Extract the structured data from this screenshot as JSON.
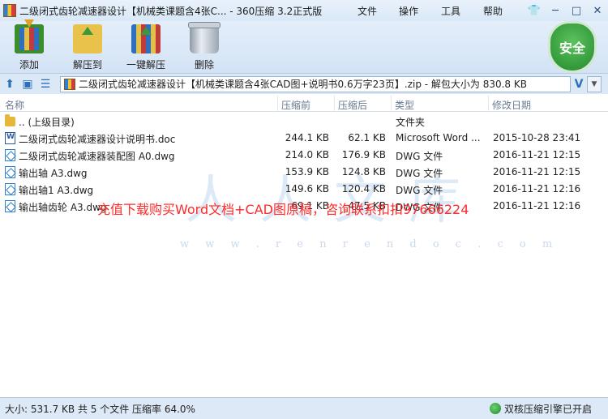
{
  "window": {
    "title": "二级闭式齿轮减速器设计【机械类课题含4张C... - 360压缩 3.2正式版",
    "menu": [
      "文件",
      "操作",
      "工具",
      "帮助"
    ],
    "controls": [
      "shirt-icon",
      "minimize-icon",
      "maximize-icon",
      "close-icon"
    ]
  },
  "toolbar": {
    "items": [
      {
        "label": "添加",
        "icon": "add-archive-icon"
      },
      {
        "label": "解压到",
        "icon": "extract-to-icon"
      },
      {
        "label": "一键解压",
        "icon": "one-click-extract-icon"
      },
      {
        "label": "删除",
        "icon": "trash-icon"
      }
    ],
    "security_badge": "安全"
  },
  "address": {
    "path": "二级闭式齿轮减速器设计【机械类课题含4张CAD图+说明书0.6万字23页】.zip - 解包大小为 830.8 KB",
    "v_label": "V"
  },
  "columns": [
    "名称",
    "压缩前",
    "压缩后",
    "类型",
    "修改日期"
  ],
  "files": [
    {
      "icon": "folder",
      "name": ".. (上级目录)",
      "size": "",
      "packed": "",
      "type": "文件夹",
      "date": ""
    },
    {
      "icon": "doc",
      "name": "二级闭式齿轮减速器设计说明书.doc",
      "size": "244.1 KB",
      "packed": "62.1 KB",
      "type": "Microsoft Word ...",
      "date": "2015-10-28 23:41"
    },
    {
      "icon": "dwg",
      "name": "二级闭式齿轮减速器装配图 A0.dwg",
      "size": "214.0 KB",
      "packed": "176.9 KB",
      "type": "DWG 文件",
      "date": "2016-11-21 12:15"
    },
    {
      "icon": "dwg",
      "name": "输出轴 A3.dwg",
      "size": "153.9 KB",
      "packed": "124.8 KB",
      "type": "DWG 文件",
      "date": "2016-11-21 12:15"
    },
    {
      "icon": "dwg",
      "name": "输出轴1 A3.dwg",
      "size": "149.6 KB",
      "packed": "120.4 KB",
      "type": "DWG 文件",
      "date": "2016-11-21 12:16"
    },
    {
      "icon": "dwg",
      "name": "输出轴齿轮 A3.dwg",
      "size": "69.1 KB",
      "packed": "47.5 KB",
      "type": "DWG 文件",
      "date": "2016-11-21 12:16"
    }
  ],
  "watermark": {
    "text": "充值下载购买Word文档+CAD图原稿，咨询联系扣扣97666224",
    "url": "w w w . r e n r e n d o c . c o m",
    "logo": "人人文库"
  },
  "status": {
    "left": "大小: 531.7 KB 共 5 个文件 压缩率 64.0%",
    "right": "双核压缩引擎已开启"
  }
}
